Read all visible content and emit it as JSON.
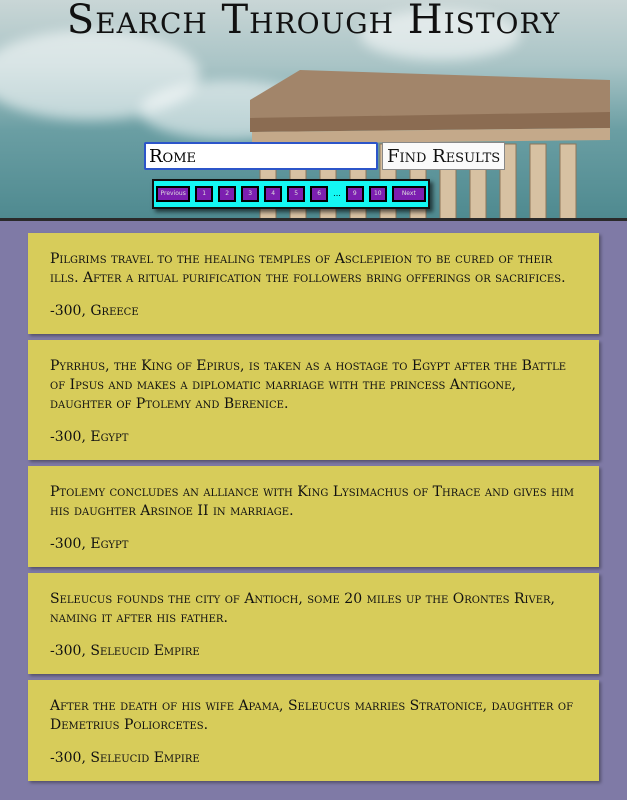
{
  "header": {
    "title": "Search Through History"
  },
  "search": {
    "value": "Rome",
    "button_label": "Find Results"
  },
  "pagination": {
    "previous_label": "Previous",
    "pages": [
      "1",
      "2",
      "3",
      "4",
      "5",
      "6"
    ],
    "ellipsis": "...",
    "trailing_pages": [
      "9",
      "10"
    ],
    "next_label": "Next"
  },
  "results": [
    {
      "description": "Pilgrims travel to the healing temples of Asclepieion to be cured of their ills. After a ritual purification the followers bring offerings or sacrifices.",
      "year": "-300",
      "place": "Greece"
    },
    {
      "description": "Pyrrhus, the King of Epirus, is taken as a hostage to Egypt after the Battle of Ipsus and makes a diplomatic marriage with the princess Antigone, daughter of Ptolemy and Berenice.",
      "year": "-300",
      "place": "Egypt"
    },
    {
      "description": "Ptolemy concludes an alliance with King Lysimachus of Thrace and gives him his daughter Arsinoe II in marriage.",
      "year": "-300",
      "place": "Egypt"
    },
    {
      "description": "Seleucus founds the city of Antioch, some 20 miles up the Orontes River, naming it after his father.",
      "year": "-300",
      "place": "Seleucid Empire"
    },
    {
      "description": "After the death of his wife Apama, Seleucus marries Stratonice, daughter of Demetrius Poliorcetes.",
      "year": "-300",
      "place": "Seleucid Empire"
    }
  ]
}
